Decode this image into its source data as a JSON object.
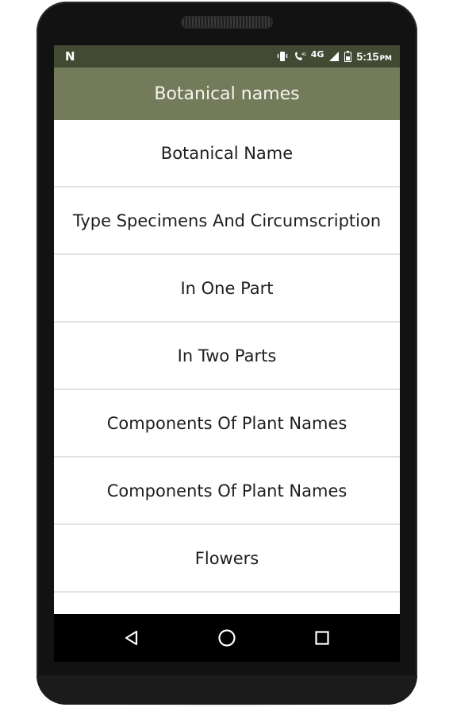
{
  "status_bar": {
    "left_icon": "N",
    "left_icon_name": "notification-n-icon",
    "network_label": "4G",
    "time": "5:15",
    "ampm": "PM"
  },
  "toolbar": {
    "title": "Botanical names"
  },
  "list": {
    "items": [
      {
        "label": "Botanical Name"
      },
      {
        "label": "Type Specimens And Circumscription"
      },
      {
        "label": "In One Part"
      },
      {
        "label": "In Two Parts"
      },
      {
        "label": "Components Of Plant Names"
      },
      {
        "label": "Components Of Plant Names"
      },
      {
        "label": "Flowers"
      },
      {
        "label": ""
      }
    ]
  },
  "nav_bar": {
    "back_icon": "back-triangle-icon",
    "home_icon": "home-circle-icon",
    "recents_icon": "recents-square-icon"
  },
  "colors": {
    "status_bar": "#434a34",
    "toolbar": "#737b5b",
    "nav_bar": "#000000",
    "phone_body": "#121212"
  }
}
